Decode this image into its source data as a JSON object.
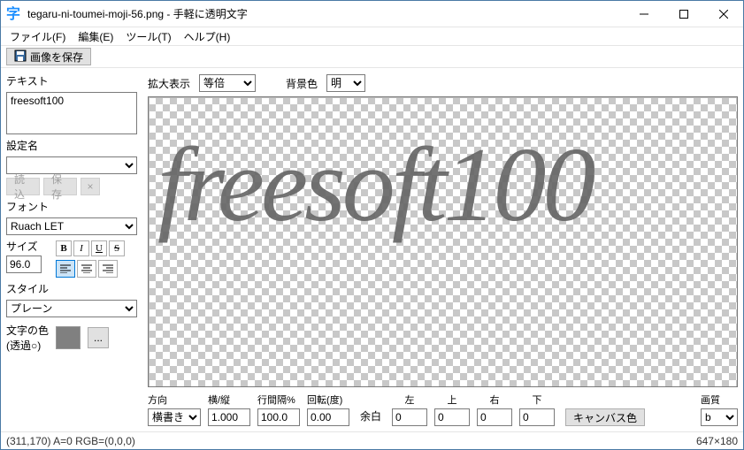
{
  "titlebar": {
    "title": "tegaru-ni-toumei-moji-56.png - 手軽に透明文字"
  },
  "menu": {
    "file": "ファイル(F)",
    "edit": "編集(E)",
    "tool": "ツール(T)",
    "help": "ヘルプ(H)"
  },
  "toolbar": {
    "save_image": "画像を保存"
  },
  "left": {
    "text_label": "テキスト",
    "text_value": "freesoft100",
    "setting_label": "設定名",
    "setting_value": "",
    "load": "読込",
    "save": "保存",
    "del": "×",
    "font_label": "フォント",
    "font_value": "Ruach LET",
    "size_label": "サイズ",
    "size_value": "96.0",
    "bold": "B",
    "italic": "I",
    "underline": "U",
    "strike": "S",
    "style_label": "スタイル",
    "style_value": "プレーン",
    "textcolor_label1": "文字の色",
    "textcolor_label2": "(透過○)"
  },
  "canvasbar": {
    "zoom_label": "拡大表示",
    "zoom_value": "等倍",
    "bg_label": "背景色",
    "bg_value": "明"
  },
  "canvas": {
    "rendered_text": "freesoft100"
  },
  "bottom": {
    "dir_label": "方向",
    "dir_value": "横書き",
    "ratio_label": "横/縦",
    "ratio_value": "1.000",
    "linegap_label": "行間隔%",
    "linegap_value": "100.0",
    "rot_label": "回転(度)",
    "rot_value": "0.00",
    "margin_label": "余白",
    "left_label": "左",
    "left_value": "0",
    "top_label": "上",
    "top_value": "0",
    "right_label": "右",
    "right_value": "0",
    "bottom_label": "下",
    "bottom_value": "0",
    "canvascolor": "キャンバス色",
    "quality_label": "画質",
    "quality_value": "b"
  },
  "status": {
    "left": "(311,170) A=0 RGB=(0,0,0)",
    "right": "647×180"
  }
}
